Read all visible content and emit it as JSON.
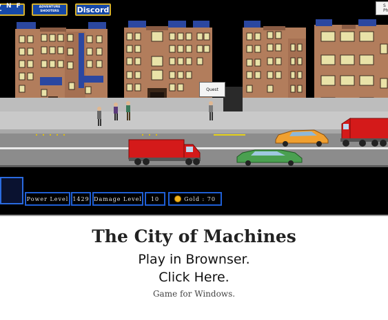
{
  "topbar": {
    "nft_label": "y N F T",
    "adventure_line1": "ADVENTURE",
    "adventure_line2": "SHOOTERS",
    "discord_label": "Discord",
    "corner_line1": "S",
    "corner_line2": "Ph"
  },
  "scene": {
    "quest_label": "Quest"
  },
  "hud": {
    "power_label": "Power Level",
    "power_value": "1429",
    "damage_label": "Damage Level",
    "damage_value": "10",
    "gold_text": "Gold : 70"
  },
  "caption": {
    "title": "The City of Machines",
    "play_line": "Play in Brownser.",
    "click_line": "Click Here.",
    "sub_line": "Game for Windows."
  },
  "colors": {
    "hud_border": "#1f5fd6",
    "button_blue": "#1548a8",
    "button_border": "#d8b12a",
    "brick": "#b07a58",
    "road": "#8c8c8c",
    "sidewalk": "#c9c9c9"
  }
}
